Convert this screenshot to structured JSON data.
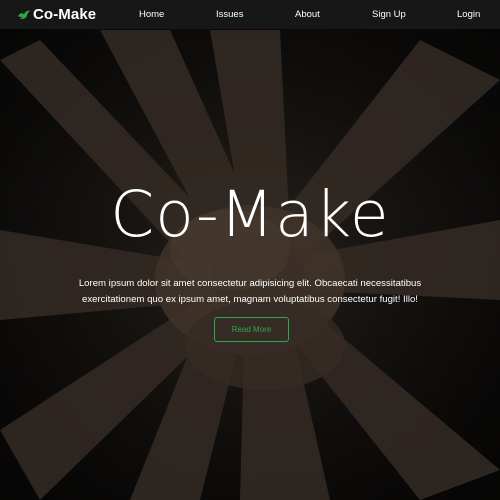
{
  "nav": {
    "brand": "Co-Make",
    "brand_icon": "bird-icon",
    "accent_color": "#2fa84a",
    "links": [
      {
        "label": "Home"
      },
      {
        "label": "Issues"
      },
      {
        "label": "About"
      },
      {
        "label": "Sign Up"
      },
      {
        "label": "Login"
      }
    ]
  },
  "hero": {
    "title": "Co-Make",
    "text": "Lorem ipsum dolor sit amet consectetur adipisicing elit. Obcaecati necessitatibus exercitationem quo ex ipsum amet, magnam voluptatibus consectetur fugit! Illo!",
    "button": "Read More"
  }
}
